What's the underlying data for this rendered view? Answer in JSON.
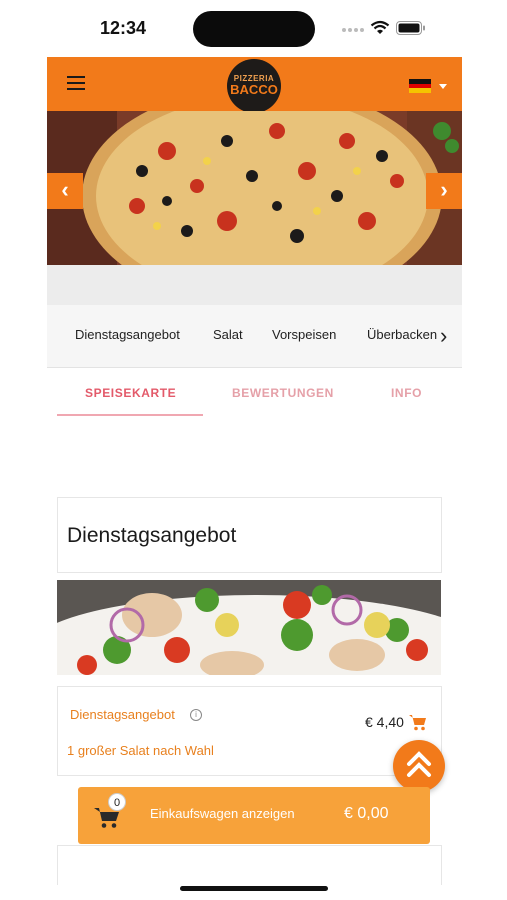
{
  "status_bar": {
    "time": "12:34"
  },
  "header": {
    "logo_line1": "PIZZERIA",
    "logo_line2": "BACCO",
    "language": "de",
    "colors": {
      "brand": "#f27a1a",
      "logo_bg": "#1e1b19"
    }
  },
  "hero": {
    "prev_icon": "chevron-left",
    "next_icon": "chevron-right"
  },
  "categories": [
    "Dienstagsangebot",
    "Salat",
    "Vorspeisen",
    "Überbacken"
  ],
  "tabs": [
    {
      "label": "SPEISEKARTE",
      "active": true
    },
    {
      "label": "BEWERTUNGEN",
      "active": false
    },
    {
      "label": "INFO",
      "active": false
    }
  ],
  "section": {
    "title": "Dienstagsangebot",
    "item": {
      "name": "Dienstagsangebot",
      "description": "1 großer Salat nach Wahl",
      "price": "€ 4,40"
    }
  },
  "cart": {
    "count": "0",
    "label": "Einkaufswagen anzeigen",
    "total": "€ 0,00",
    "colors": {
      "bar": "#f7a23a"
    }
  }
}
